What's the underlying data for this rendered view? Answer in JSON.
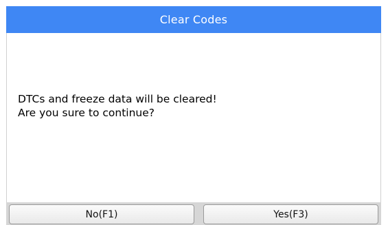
{
  "dialog": {
    "title": "Clear Codes",
    "message_line1": "DTCs and freeze data will be cleared!",
    "message_line2": "Are you sure to continue?"
  },
  "buttons": {
    "no_label": "No(F1)",
    "yes_label": "Yes(F3)"
  },
  "colors": {
    "title_bar": "#3f87f4",
    "title_text": "#ffffff",
    "button_bar": "#d6d6d6"
  }
}
